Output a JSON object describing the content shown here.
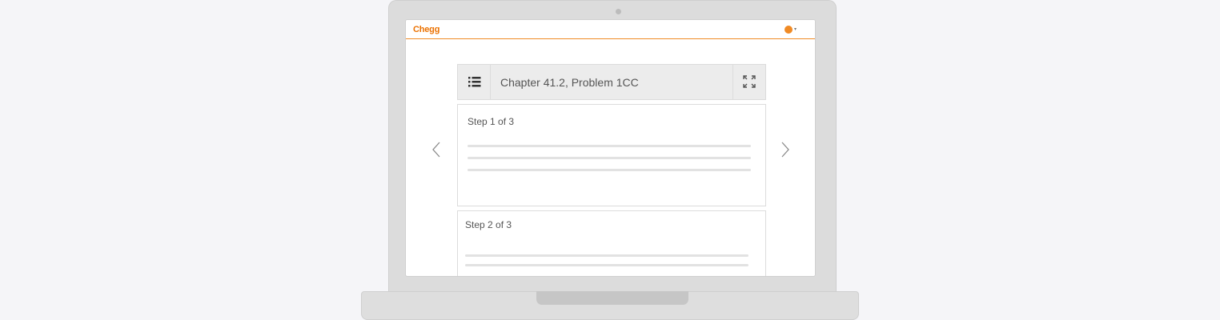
{
  "app": {
    "logo_text": "Chegg",
    "accent_color": "#f08a24"
  },
  "header": {
    "toc_icon": "list-icon",
    "title": "Chapter 41.2, Problem 1CC",
    "expand_icon": "expand-icon"
  },
  "navigation": {
    "prev_icon": "chevron-left-icon",
    "next_icon": "chevron-right-icon"
  },
  "user_menu": {
    "avatar_icon": "avatar-icon",
    "caret_icon": "caret-down-icon",
    "caret_glyph": "▾"
  },
  "steps": [
    {
      "label": "Step 1 of 3"
    },
    {
      "label": "Step 2 of 3"
    }
  ]
}
